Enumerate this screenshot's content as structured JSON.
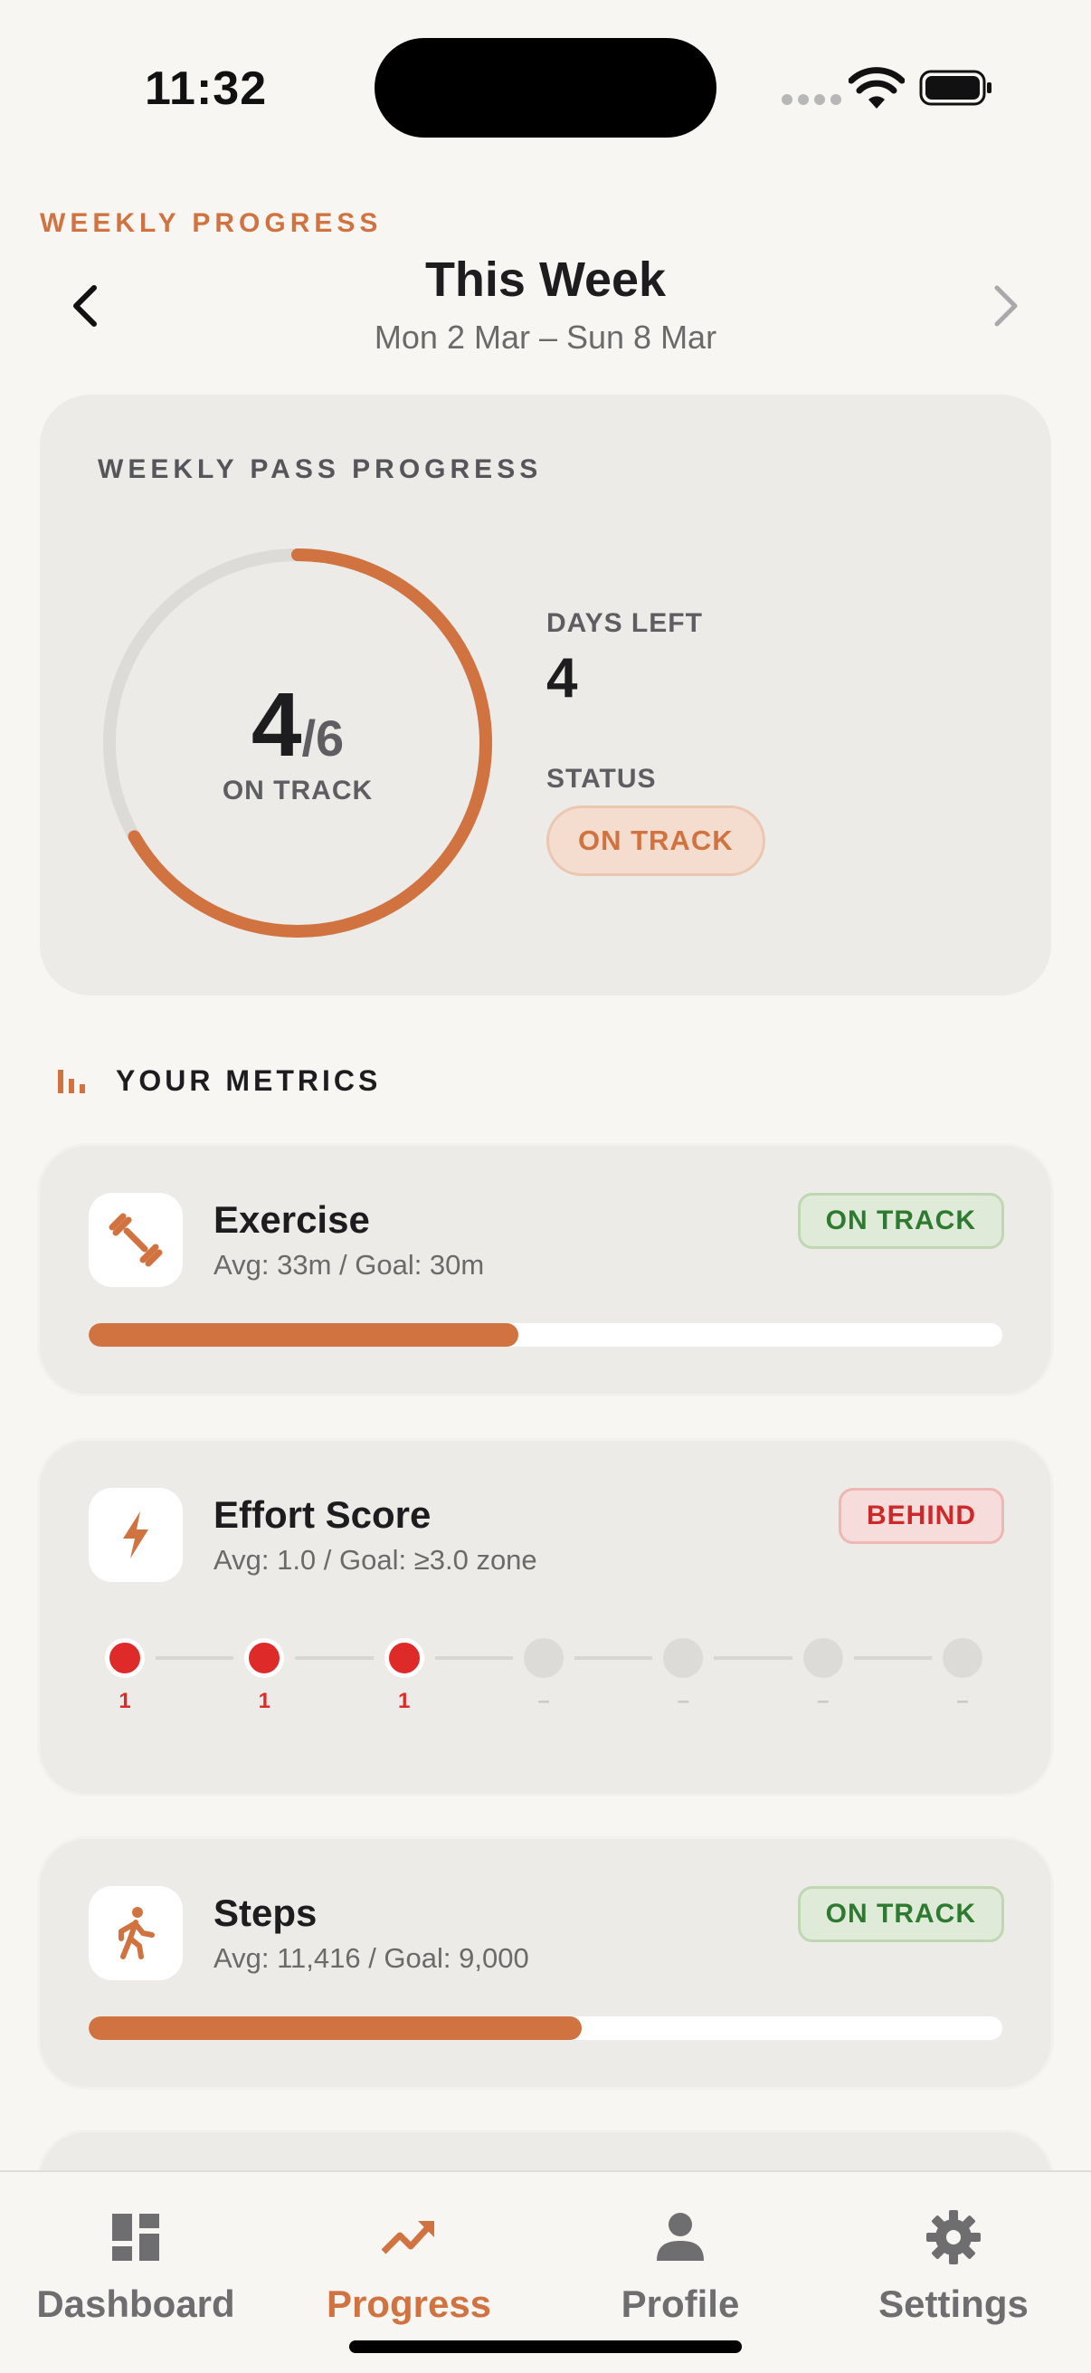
{
  "status_bar": {
    "time": "11:32"
  },
  "header": {
    "eyebrow": "WEEKLY PROGRESS",
    "title": "This Week",
    "range": "Mon 2 Mar – Sun 8 Mar"
  },
  "pass_card": {
    "label": "WEEKLY PASS PROGRESS",
    "completed": "4",
    "total": "/6",
    "progress_fraction": 0.667,
    "ring_status": "ON TRACK",
    "days_left_label": "DAYS LEFT",
    "days_left_value": "4",
    "status_label": "STATUS",
    "status_value": "ON TRACK",
    "accent_color": "#D07340"
  },
  "metrics": {
    "title": "YOUR METRICS",
    "items": [
      {
        "icon": "dumbbell-icon",
        "title": "Exercise",
        "subtitle": "Avg: 33m / Goal: 30m",
        "badge": "ON TRACK",
        "badge_type": "good",
        "progress_percent": 47
      },
      {
        "icon": "bolt-icon",
        "title": "Effort Score",
        "subtitle": "Avg: 1.0 / Goal: ≥3.0 zone",
        "badge": "BEHIND",
        "badge_type": "bad",
        "days": [
          {
            "value": "1",
            "active": true
          },
          {
            "value": "1",
            "active": true
          },
          {
            "value": "1",
            "active": true
          },
          {
            "value": "–",
            "active": false
          },
          {
            "value": "–",
            "active": false
          },
          {
            "value": "–",
            "active": false
          },
          {
            "value": "–",
            "active": false
          }
        ]
      },
      {
        "icon": "walking-icon",
        "title": "Steps",
        "subtitle": "Avg: 11,416 / Goal: 9,000",
        "badge": "ON TRACK",
        "badge_type": "good",
        "progress_percent": 54
      }
    ]
  },
  "tabbar": {
    "tabs": [
      {
        "label": "Dashboard",
        "icon": "dashboard-icon",
        "active": false
      },
      {
        "label": "Progress",
        "icon": "trending-up-icon",
        "active": true
      },
      {
        "label": "Profile",
        "icon": "person-icon",
        "active": false
      },
      {
        "label": "Settings",
        "icon": "gear-icon",
        "active": false
      }
    ]
  }
}
